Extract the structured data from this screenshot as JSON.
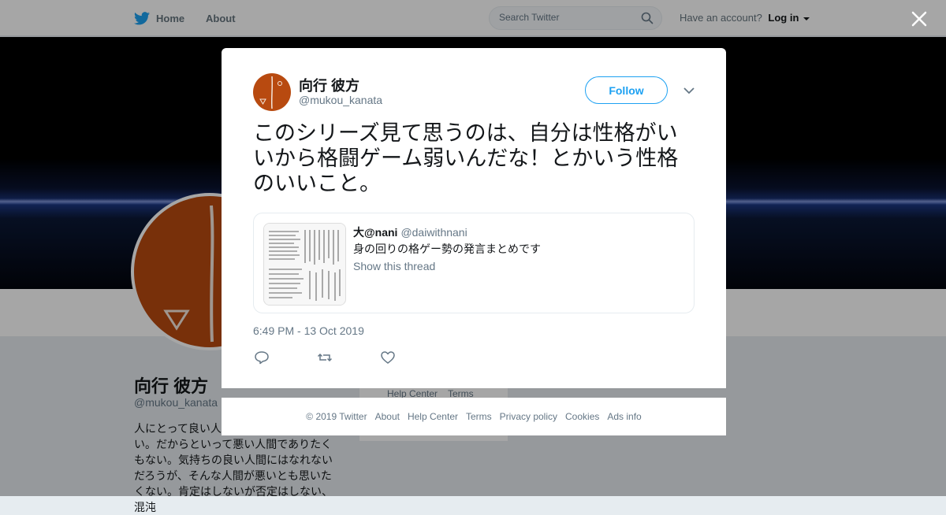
{
  "topbar": {
    "home_label": "Home",
    "about_label": "About",
    "search_placeholder": "Search Twitter",
    "account_prompt": "Have an account?",
    "login_label": "Log in"
  },
  "profile": {
    "name": "向行 彼方",
    "handle": "@mukou_kanata",
    "bio": "人にとって良い人間でありたいと思わない。だからといって悪い人間でありたくもない。気持ちの良い人間にはなれないだろうが、そんな人間が悪いとも思いたくない。肯定はしないが否定はしない、混沌",
    "side_links": [
      "Help Center",
      "Terms"
    ]
  },
  "tweet": {
    "author_name": "向行 彼方",
    "author_handle": "@mukou_kanata",
    "follow_label": "Follow",
    "text": "このシリーズ見て思うのは、自分は性格がいいから格闘ゲーム弱いんだな！とかいう性格のいいこと。",
    "timestamp": "6:49 PM - 13 Oct 2019",
    "quoted": {
      "name": "大@nani",
      "handle": "@daiwithnani",
      "text": "身の回りの格ゲー勢の発言まとめです",
      "thread_label": "Show this thread"
    }
  },
  "footer": {
    "links": [
      "© 2019 Twitter",
      "About",
      "Help Center",
      "Terms",
      "Privacy policy",
      "Cookies",
      "Ads info"
    ]
  },
  "colors": {
    "brand": "#1da1f2",
    "avatar": "#b84a10",
    "muted_text": "#657786"
  }
}
